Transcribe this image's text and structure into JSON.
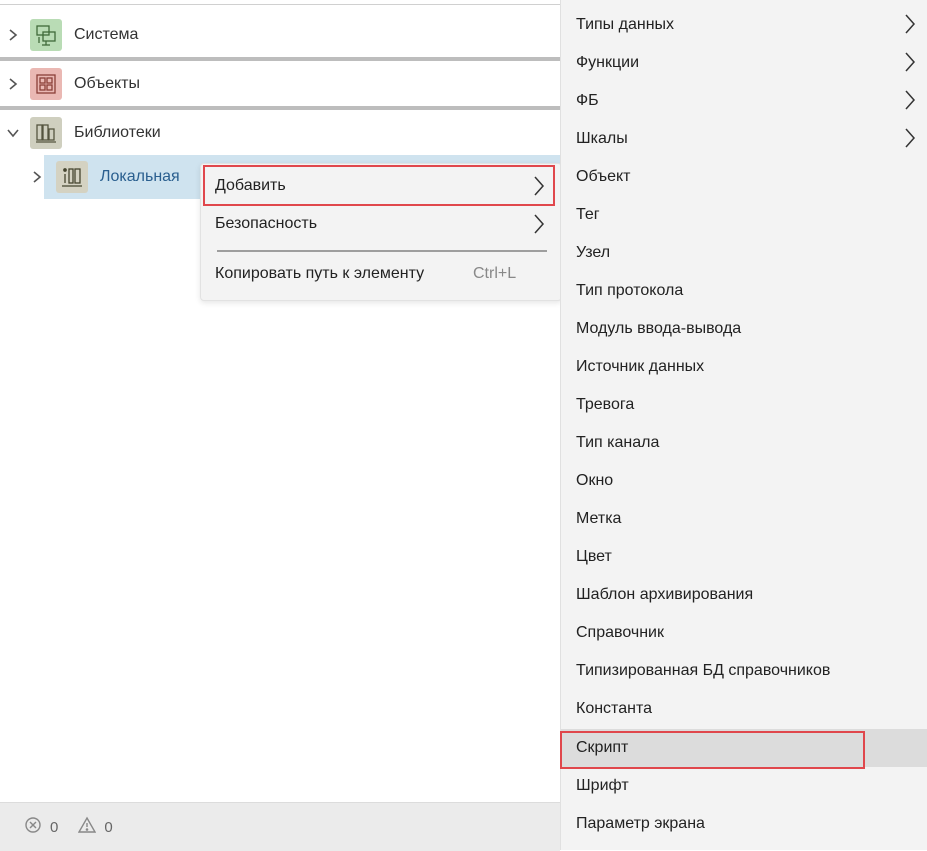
{
  "tree": {
    "items": [
      {
        "label": "Система",
        "icon": "system-icon",
        "expanded": false
      },
      {
        "label": "Объекты",
        "icon": "objects-icon",
        "expanded": false
      },
      {
        "label": "Библиотеки",
        "icon": "libraries-icon",
        "expanded": true
      }
    ],
    "child": {
      "label": "Локальная",
      "icon": "local-library-icon",
      "selected": true
    }
  },
  "context_menu": {
    "items": [
      {
        "label": "Добавить",
        "submenu": true,
        "highlighted": true
      },
      {
        "label": "Безопасность",
        "submenu": true
      },
      {
        "label": "Копировать путь к элементу",
        "shortcut": "Ctrl+L"
      }
    ]
  },
  "submenu": {
    "items": [
      {
        "label": "Типы данных",
        "submenu": true
      },
      {
        "label": "Функции",
        "submenu": true
      },
      {
        "label": "ФБ",
        "submenu": true
      },
      {
        "label": "Шкалы",
        "submenu": true
      },
      {
        "label": "Объект"
      },
      {
        "label": "Тег"
      },
      {
        "label": "Узел"
      },
      {
        "label": "Тип протокола"
      },
      {
        "label": "Модуль ввода-вывода"
      },
      {
        "label": "Источник данных"
      },
      {
        "label": "Тревога"
      },
      {
        "label": "Тип канала"
      },
      {
        "label": "Окно"
      },
      {
        "label": "Метка"
      },
      {
        "label": "Цвет"
      },
      {
        "label": "Шаблон архивирования"
      },
      {
        "label": "Справочник"
      },
      {
        "label": "Типизированная БД справочников"
      },
      {
        "label": "Константа"
      },
      {
        "label": "Скрипт",
        "highlighted": true
      },
      {
        "label": "Шрифт"
      },
      {
        "label": "Параметр экрана"
      }
    ]
  },
  "status_bar": {
    "errors": "0",
    "warnings": "0"
  },
  "colors": {
    "selection": "#cfe3ef",
    "highlight_border": "#e0474c",
    "system_icon_bg": "#b9dcb5",
    "objects_icon_bg": "#eab8b3",
    "libraries_icon_bg": "#cfcfbf",
    "local_icon_bg": "#d4d2c2",
    "local_label": "#2a5f8f"
  }
}
